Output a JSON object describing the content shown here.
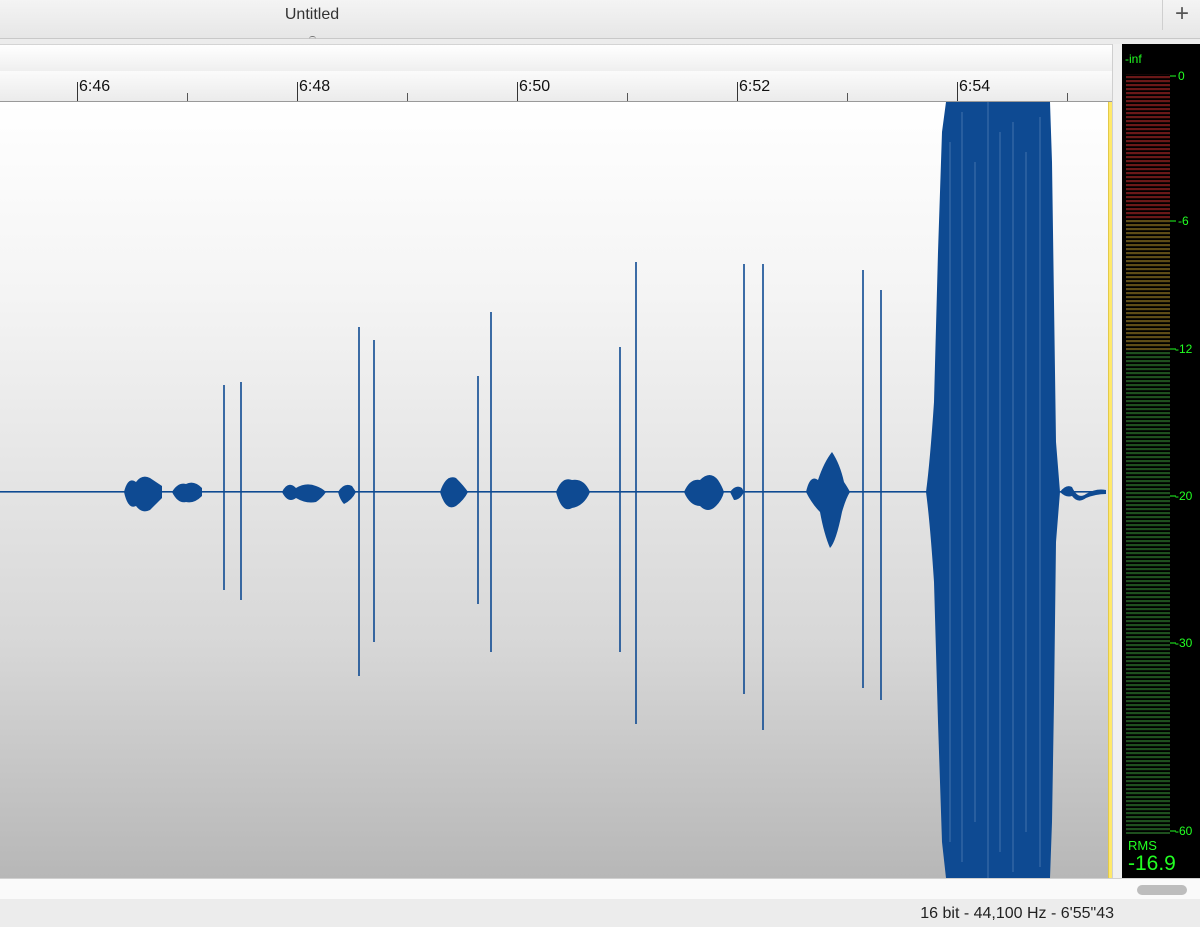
{
  "window": {
    "tab_title": "Untitled",
    "add_tab_icon": "+"
  },
  "timeline": {
    "labels": [
      "6:46",
      "6:48",
      "6:50",
      "6:52",
      "6:54"
    ]
  },
  "meter": {
    "inf_label": "-inf",
    "scale": [
      "0",
      "-6",
      "-12",
      "-20",
      "-30",
      "-60"
    ],
    "rms_label": "RMS",
    "rms_value": "-16.9",
    "colors": {
      "text": "#22ff22",
      "segment_red": "#5a1414",
      "segment_amber": "#5a4a14",
      "segment_green": "#1c4a1c"
    }
  },
  "status": {
    "text": "16 bit - 44,100 Hz - 6'55\"43"
  },
  "colors": {
    "waveform": "#0e4a92",
    "playhead": "#ffe96a"
  }
}
